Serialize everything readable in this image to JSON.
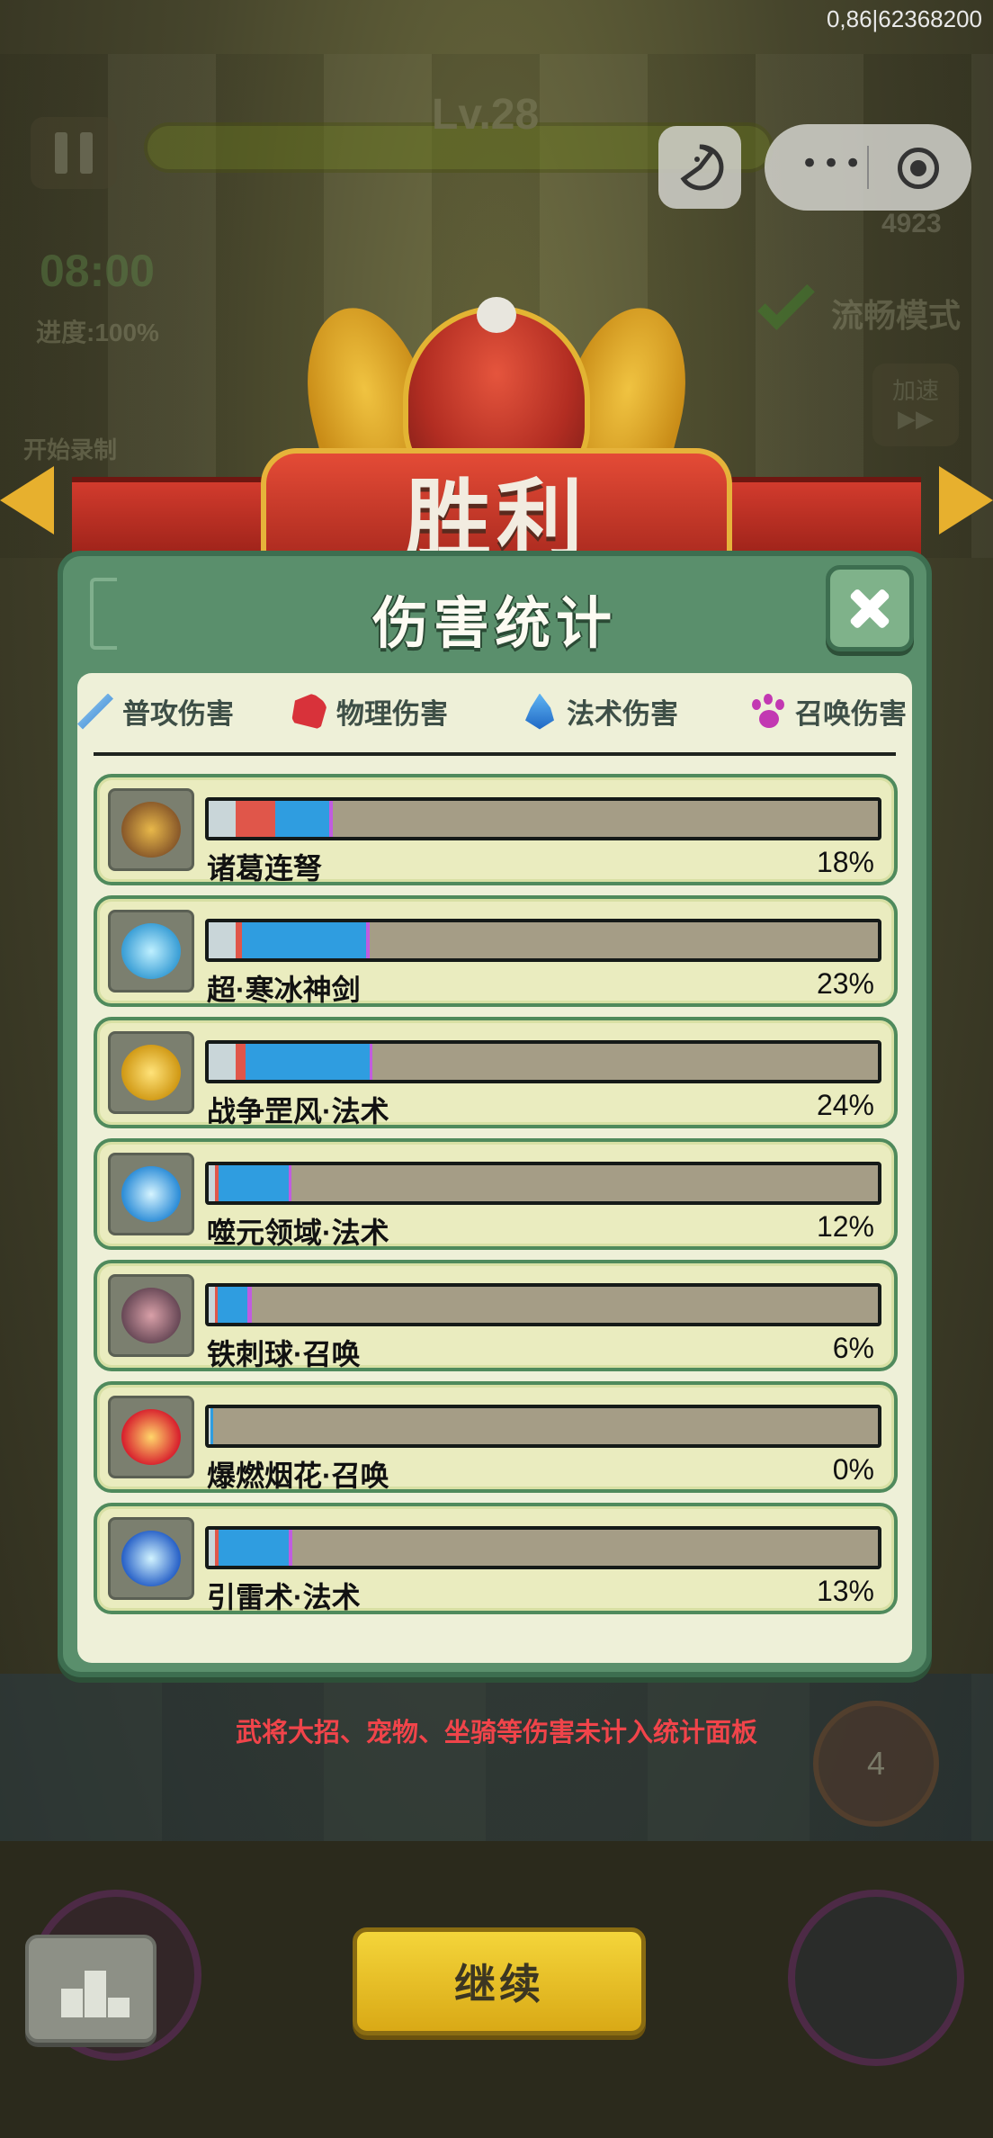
{
  "status_bar": {
    "id_text": "0,86|62368200"
  },
  "hud": {
    "level": "Lv.28",
    "timer": "08:00",
    "progress": "进度:100%",
    "record_label": "开始录制",
    "smooth_mode": "流畅模式",
    "speed_label": "加速",
    "speed_arrows": "▶▶",
    "kill_count": "4923"
  },
  "victory_title": "胜利",
  "panel": {
    "title": "伤害统计",
    "tabs": [
      {
        "label": "普攻伤害",
        "icon": "sword-icon"
      },
      {
        "label": "物理伤害",
        "icon": "fist-icon"
      },
      {
        "label": "法术伤害",
        "icon": "flame-icon"
      },
      {
        "label": "召唤伤害",
        "icon": "paw-icon"
      }
    ],
    "rows": [
      {
        "name": "诸葛连弩",
        "percent": "18%",
        "percent_value": 18,
        "icon": "crossbow-icon",
        "segments": [
          {
            "type": "white",
            "f": 0.04
          },
          {
            "type": "red",
            "f": 0.06
          },
          {
            "type": "blue",
            "f": 0.08
          },
          {
            "type": "purple",
            "f": 0.005
          }
        ]
      },
      {
        "name": "超·寒冰神剑",
        "percent": "23%",
        "percent_value": 23,
        "icon": "ice-sword-icon",
        "segments": [
          {
            "type": "white",
            "f": 0.04
          },
          {
            "type": "red",
            "f": 0.01
          },
          {
            "type": "blue",
            "f": 0.185
          },
          {
            "type": "purple",
            "f": 0.005
          }
        ]
      },
      {
        "name": "战争罡风·法术",
        "percent": "24%",
        "percent_value": 24,
        "icon": "war-wind-icon",
        "segments": [
          {
            "type": "white",
            "f": 0.04
          },
          {
            "type": "red",
            "f": 0.015
          },
          {
            "type": "blue",
            "f": 0.185
          },
          {
            "type": "purple",
            "f": 0.005
          }
        ]
      },
      {
        "name": "噬元领域·法术",
        "percent": "12%",
        "percent_value": 12,
        "icon": "vortex-icon",
        "segments": [
          {
            "type": "white",
            "f": 0.01
          },
          {
            "type": "red",
            "f": 0.005
          },
          {
            "type": "blue",
            "f": 0.105
          },
          {
            "type": "purple",
            "f": 0.004
          }
        ]
      },
      {
        "name": "铁刺球·召唤",
        "percent": "6%",
        "percent_value": 6,
        "icon": "spike-ball-icon",
        "segments": [
          {
            "type": "white",
            "f": 0.01
          },
          {
            "type": "red",
            "f": 0.003
          },
          {
            "type": "blue",
            "f": 0.045
          },
          {
            "type": "purple",
            "f": 0.006
          }
        ]
      },
      {
        "name": "爆燃烟花·召唤",
        "percent": "0%",
        "percent_value": 0,
        "icon": "firework-icon",
        "segments": [
          {
            "type": "white",
            "f": 0.003
          },
          {
            "type": "blue",
            "f": 0.004
          }
        ]
      },
      {
        "name": "引雷术·法术",
        "percent": "13%",
        "percent_value": 13,
        "icon": "thunder-icon",
        "segments": [
          {
            "type": "white",
            "f": 0.01
          },
          {
            "type": "red",
            "f": 0.005
          },
          {
            "type": "blue",
            "f": 0.105
          },
          {
            "type": "purple",
            "f": 0.005
          }
        ]
      }
    ]
  },
  "footer_note": "武将大招、宠物、坐骑等伤害未计入统计面板",
  "continue_label": "继续",
  "skill_badge": "4",
  "colors": {
    "panel_green": "#5a8f6c",
    "bar_bg": "#a59d86",
    "seg_white": "#c9d6d9",
    "seg_red": "#e0564a",
    "seg_blue": "#2f9de0",
    "seg_purple": "#c05ce0",
    "note_red": "#f0444a",
    "continue_yellow": "#f4d53a"
  }
}
